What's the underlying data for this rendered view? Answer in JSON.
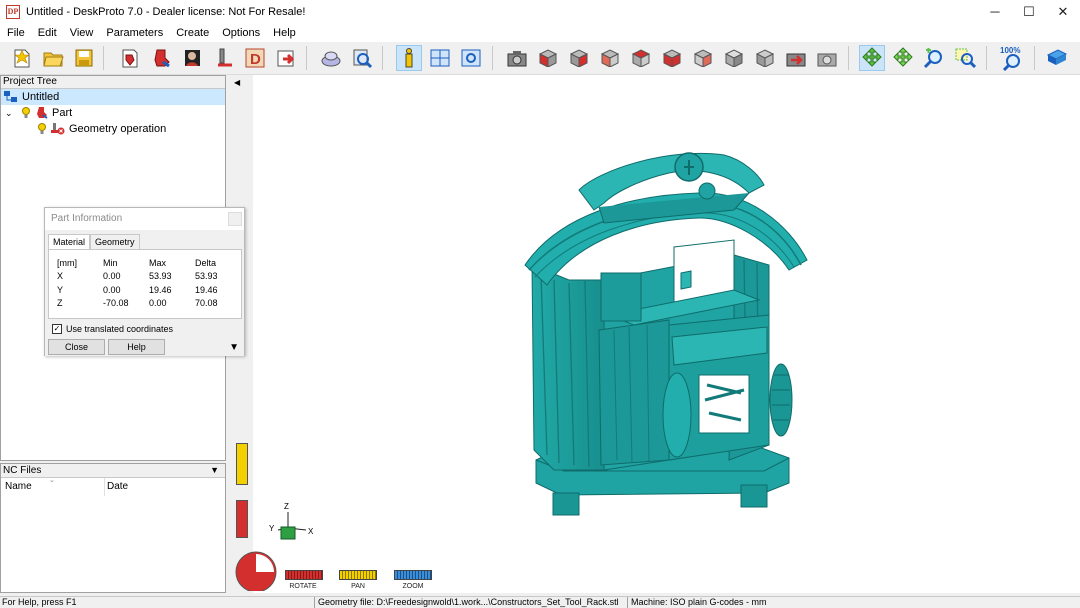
{
  "window": {
    "title": "Untitled - DeskProto 7.0 - Dealer license: Not For Resale!",
    "icon_text": "DP",
    "minimize": "─",
    "maximize": "☐",
    "close": "✕"
  },
  "menu": [
    "File",
    "Edit",
    "View",
    "Parameters",
    "Create",
    "Options",
    "Help"
  ],
  "toolbar": {
    "zoom_label": "100%",
    "icons": [
      "new-project-icon",
      "open-folder-icon",
      "save-icon",
      "open-geometry-icon",
      "part-icon",
      "image-icon",
      "toolpath-icon",
      "d-icon",
      "export-icon",
      "layers-icon",
      "inspect-icon",
      "info-icon",
      "split-view-icon",
      "screen-icon",
      "camera-icon",
      "red-cube-icon",
      "red-cube-front-icon",
      "cube-side-icon",
      "cube-top-icon",
      "cube-bottom-icon",
      "cube-back-icon",
      "grey-cube-icon",
      "grey-cube-2-icon",
      "reset-view-icon",
      "camera-grey-icon",
      "rotate-mode-icon",
      "pan-mode-icon",
      "zoom-mode-icon",
      "zoom-window-icon",
      "zoom-100-icon",
      "book-icon"
    ]
  },
  "project_tree": {
    "header": "Project Tree",
    "root": "Untitled",
    "part": "Part",
    "operation": "Geometry operation"
  },
  "nc_files": {
    "header": "NC Files",
    "col_name": "Name",
    "col_date": "Date"
  },
  "part_info": {
    "title": "Part Information",
    "tabs": [
      "Material",
      "Geometry"
    ],
    "header_row": [
      "[mm]",
      "Min",
      "Max",
      "Delta"
    ],
    "rows": [
      [
        "X",
        "0.00",
        "53.93",
        "53.93"
      ],
      [
        "Y",
        "0.00",
        "19.46",
        "19.46"
      ],
      [
        "Z",
        "-70.08",
        "0.00",
        "70.08"
      ]
    ],
    "checkbox_label": "Use translated coordinates",
    "checkbox_checked": "✓",
    "close_label": "Close",
    "help_label": "Help"
  },
  "view_controls": {
    "rotate": "ROTATE",
    "pan": "PAN",
    "zoom": "ZOOM"
  },
  "axis": {
    "x": "X",
    "y": "Y",
    "z": "Z"
  },
  "status": {
    "help": "For Help, press F1",
    "geometry": "Geometry file: D:\\Freedesignwold\\1.work...\\Constructors_Set_Tool_Rack.stl",
    "machine": "Machine: ISO plain G-codes - mm"
  },
  "colors": {
    "model": "#1fa3a3",
    "model_dark": "#137a7a",
    "model_light": "#3fc4c2",
    "selection": "#cce8ff"
  }
}
